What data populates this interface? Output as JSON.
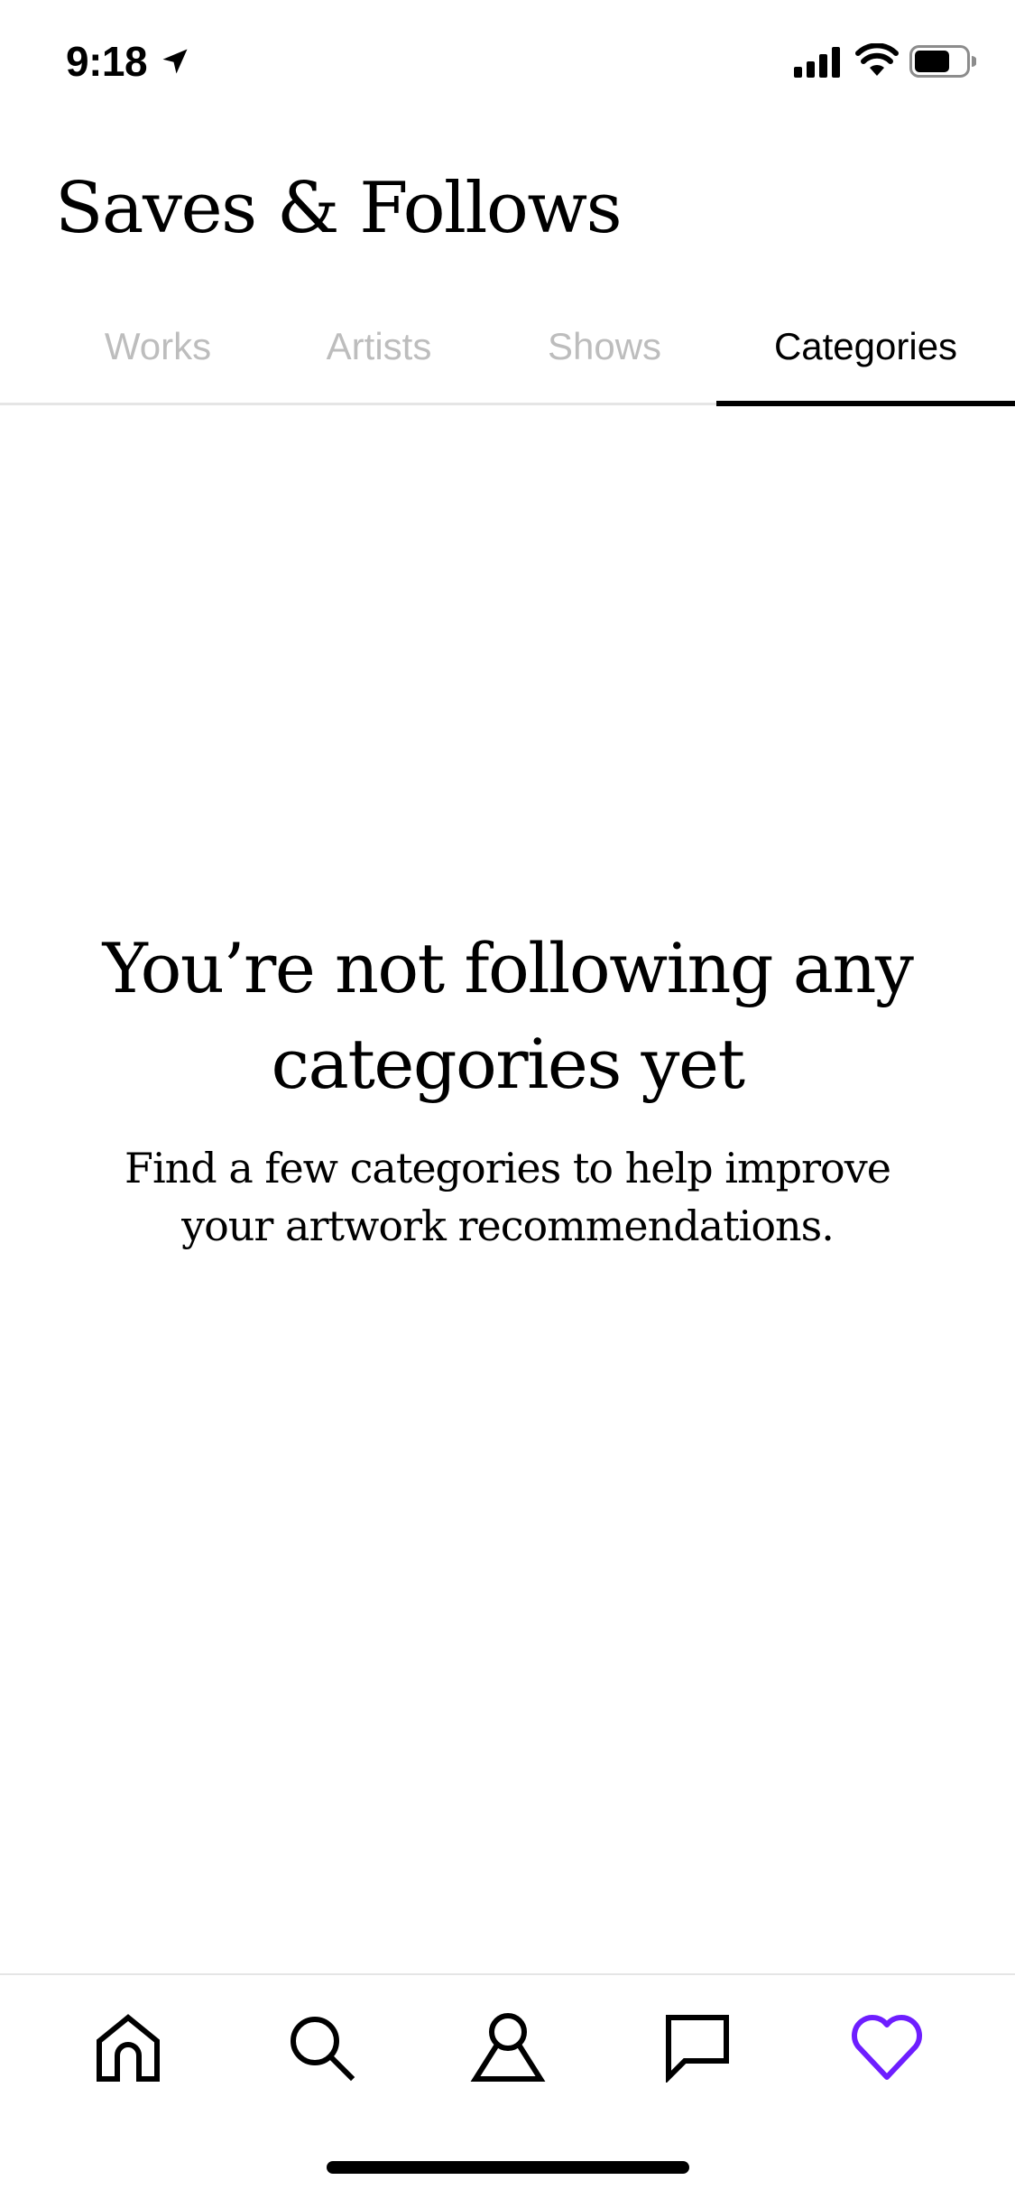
{
  "status_bar": {
    "time": "9:18",
    "location_icon": "location-arrow-icon",
    "signal_icon": "cellular-signal-icon",
    "wifi_icon": "wifi-icon",
    "battery_icon": "battery-icon"
  },
  "header": {
    "title": "Saves & Follows"
  },
  "tabs": [
    {
      "label": "Works",
      "active": false
    },
    {
      "label": "Artists",
      "active": false
    },
    {
      "label": "Shows",
      "active": false
    },
    {
      "label": "Categories",
      "active": true
    }
  ],
  "empty_state": {
    "heading": "You’re not following any categories yet",
    "subtext": "Find a few categories to help improve your artwork recommendations."
  },
  "bottom_nav": [
    {
      "icon": "home-icon",
      "active": false
    },
    {
      "icon": "search-icon",
      "active": false
    },
    {
      "icon": "profile-icon",
      "active": false
    },
    {
      "icon": "inbox-icon",
      "active": false
    },
    {
      "icon": "heart-icon",
      "active": true
    }
  ],
  "colors": {
    "accent": "#6E1EFF",
    "inactive_tab": "#BDBDBD",
    "divider": "#E5E5E5",
    "text": "#000000"
  }
}
